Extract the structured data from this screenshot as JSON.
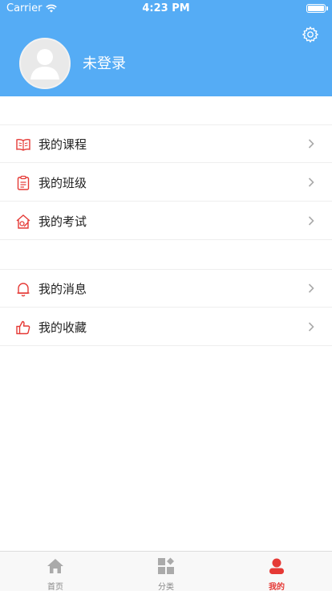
{
  "status": {
    "carrier": "Carrier",
    "time": "4:23 PM"
  },
  "header": {
    "login_text": "未登录"
  },
  "menu_group1": [
    {
      "label": "我的课程",
      "icon": "book-icon"
    },
    {
      "label": "我的班级",
      "icon": "clipboard-icon"
    },
    {
      "label": "我的考试",
      "icon": "exam-icon"
    }
  ],
  "menu_group2": [
    {
      "label": "我的消息",
      "icon": "bell-icon"
    },
    {
      "label": "我的收藏",
      "icon": "thumbs-up-icon"
    }
  ],
  "tabs": [
    {
      "label": "首页",
      "icon": "home-icon"
    },
    {
      "label": "分类",
      "icon": "category-icon"
    },
    {
      "label": "我的",
      "icon": "user-icon",
      "active": true
    }
  ],
  "colors": {
    "header": "#55acf5",
    "accent": "#e53935",
    "icon_gray": "#aaaaaa"
  }
}
